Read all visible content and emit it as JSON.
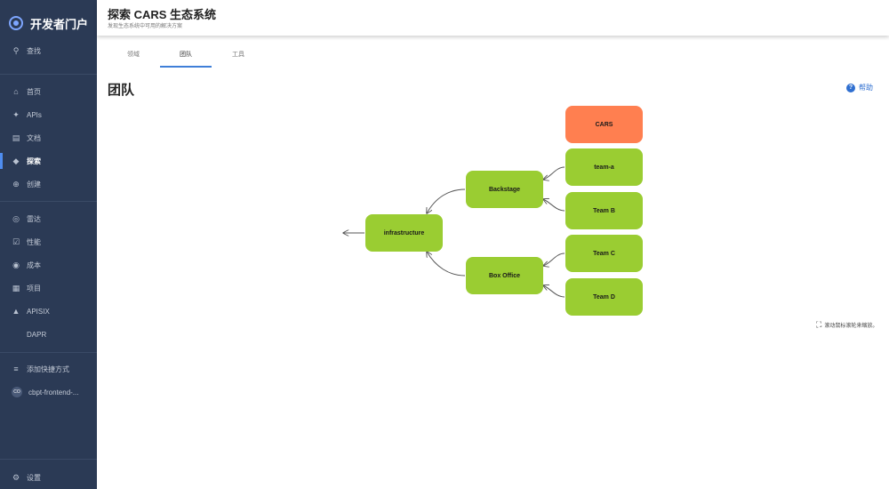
{
  "sidebar": {
    "brand": "开发者门户",
    "search": "查找",
    "items": [
      {
        "label": "首页",
        "icon": "home-icon"
      },
      {
        "label": "APIs",
        "icon": "puzzle-icon"
      },
      {
        "label": "文档",
        "icon": "docs-icon"
      },
      {
        "label": "探索",
        "icon": "layers-icon"
      },
      {
        "label": "创建",
        "icon": "plus-circle-icon"
      },
      {
        "label": "雷达",
        "icon": "radar-icon"
      },
      {
        "label": "性能",
        "icon": "check-square-icon"
      },
      {
        "label": "成本",
        "icon": "money-icon"
      },
      {
        "label": "项目",
        "icon": "clipboard-icon"
      },
      {
        "label": "APISIX",
        "icon": "apisix-icon"
      },
      {
        "label": "DAPR",
        "icon": ""
      }
    ],
    "shortcut_add": "添加快捷方式",
    "shortcut_item": "cbpt-frontend-...",
    "shortcut_avatar": "CO",
    "settings": "设置"
  },
  "header": {
    "title": "探索 CARS 生态系统",
    "subtitle": "发现生态系统中可用的解决方案"
  },
  "tabs": [
    {
      "label": "领域"
    },
    {
      "label": "团队"
    },
    {
      "label": "工具"
    }
  ],
  "active_tab": "团队",
  "page": {
    "title": "团队",
    "help": "帮助"
  },
  "graph": {
    "nodes": [
      {
        "id": "cars",
        "label": "CARS"
      },
      {
        "id": "team-a",
        "label": "team-a"
      },
      {
        "id": "backstage",
        "label": "Backstage"
      },
      {
        "id": "team-b",
        "label": "Team B"
      },
      {
        "id": "infrastructure",
        "label": "infrastructure"
      },
      {
        "id": "team-c",
        "label": "Team C"
      },
      {
        "id": "box-office",
        "label": "Box Office"
      },
      {
        "id": "team-d",
        "label": "Team D"
      }
    ],
    "colors": {
      "root": "#ff7f50",
      "node": "#9acd32",
      "edge": "#555555"
    }
  },
  "zoom_hint": "滚动鼠标滚轮来缩放。"
}
